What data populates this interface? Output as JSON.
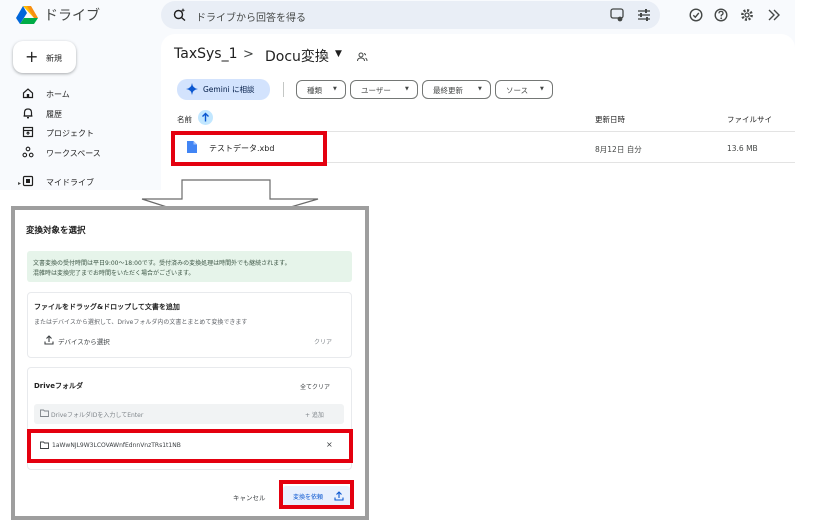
{
  "app": {
    "name": "ドライブ"
  },
  "search": {
    "placeholder": "ドライブから回答を得る"
  },
  "toolbar": {
    "icons": [
      "tune-icon",
      "filter-icon",
      "status-check-icon",
      "help-icon",
      "settings-icon",
      "gemini-spark-icon"
    ]
  },
  "sidebar": {
    "new_label": "新規",
    "items": [
      {
        "label": "ホーム",
        "icon": "home-icon"
      },
      {
        "label": "履歴",
        "icon": "bell-icon"
      },
      {
        "label": "プロジェクト",
        "icon": "project-icon"
      },
      {
        "label": "ワークスペース",
        "icon": "workspace-icon"
      },
      {
        "label": "マイドライブ",
        "icon": "my-drive-icon"
      }
    ]
  },
  "breadcrumb": {
    "root": "TaxSys_1",
    "separator": ">",
    "current": "Docu変換"
  },
  "filters": {
    "gemini_label": "Gemini に相談",
    "chips": [
      "種類",
      "ユーザー",
      "最終更新",
      "ソース"
    ]
  },
  "table": {
    "columns": [
      "名前",
      "更新日時",
      "ファイルサイ"
    ],
    "rows": [
      {
        "name": "テストデータ.xbd",
        "modified": "8月12日 自分",
        "size": "13.6 MB"
      }
    ]
  },
  "dialog": {
    "title": "変換対象を選択",
    "notice_lines": [
      "文書変換の受付時間は平日9:00〜18:00です。受付済みの変換処理は時間外でも継続されます。",
      "混雑時は変換完了までお時間をいただく場合がございます。"
    ],
    "upload": {
      "title": "ファイルをドラッグ&ドロップして文書を追加",
      "subtitle": "またはデバイスから選択して、Driveフォルダ内の文書とまとめて変換できます",
      "device_button": "デバイスから選択",
      "clear_label": "クリア"
    },
    "drive": {
      "title": "Driveフォルダ",
      "clear_all": "全てクリア",
      "input_placeholder": "DriveフォルダIDを入力してEnter",
      "add_label": "+ 追加",
      "folders": [
        {
          "id": "1aWwNJL9W3LCOVAWnfEdnnVnzTRs1t1NB"
        }
      ]
    },
    "cancel_label": "キャンセル",
    "submit_label": "変換を依頼"
  },
  "colors": {
    "accent": "#0b57d0",
    "highlight": "#e4000f",
    "notice_bg": "#e6f4ea",
    "gemini_bg": "#d3e3fd"
  }
}
